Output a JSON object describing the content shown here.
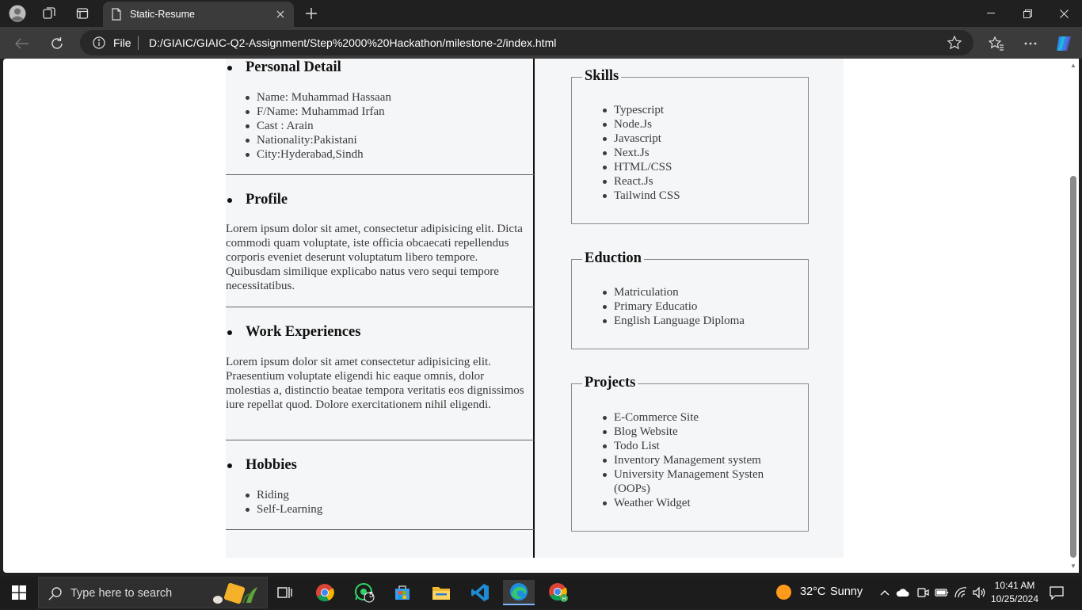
{
  "browser": {
    "tab_title": "Static-Resume",
    "address_scheme": "File",
    "address_url": "D:/GIAIC/GIAIC-Q2-Assignment/Step%2000%20Hackathon/milestone-2/index.html"
  },
  "resume": {
    "personal": {
      "heading": "Personal Detail",
      "items": [
        "Name: Muhammad Hassaan",
        "F/Name: Muhammad Irfan",
        "Cast : Arain",
        "Nationality:Pakistani",
        "City:Hyderabad,Sindh"
      ]
    },
    "profile": {
      "heading": "Profile",
      "text": "Lorem ipsum dolor sit amet, consectetur adipisicing elit. Dicta commodi quam voluptate, iste officia obcaecati repellendus corporis eveniet deserunt voluptatum libero tempore. Quibusdam similique explicabo natus vero sequi tempore necessitatibus."
    },
    "work": {
      "heading": "Work Experiences",
      "text": "Lorem ipsum dolor sit amet consectetur adipisicing elit. Praesentium voluptate eligendi hic eaque omnis, dolor molestias a, distinctio beatae tempora veritatis eos dignissimos iure repellat quod. Dolore exercitationem nihil eligendi."
    },
    "hobbies": {
      "heading": "Hobbies",
      "items": [
        "Riding",
        "Self-Learning"
      ]
    },
    "skills": {
      "heading": "Skills",
      "items": [
        "Typescript",
        "Node.Js",
        "Javascript",
        "Next.Js",
        "HTML/CSS",
        "React.Js",
        "Tailwind CSS"
      ]
    },
    "education": {
      "heading": "Eduction",
      "items": [
        "Matriculation",
        "Primary Educatio",
        "English Language Diploma"
      ]
    },
    "projects": {
      "heading": "Projects",
      "items": [
        "E-Commerce Site",
        "Blog Website",
        "Todo List",
        "Inventory Management system",
        "University Management Systen (OOPs)",
        "Weather Widget"
      ]
    }
  },
  "taskbar": {
    "search_placeholder": "Type here to search",
    "whatsapp_badge": "5",
    "weather_temp": "32°C",
    "weather_condition": "Sunny",
    "time": "10:41 AM",
    "date": "10/25/2024"
  },
  "colors": {
    "page_bg": "#f5f6f8",
    "chrome_dark": "#202020",
    "toolbar": "#3b3b3b",
    "taskbar": "#1c1c1c",
    "accent": "#7cb7ff"
  }
}
